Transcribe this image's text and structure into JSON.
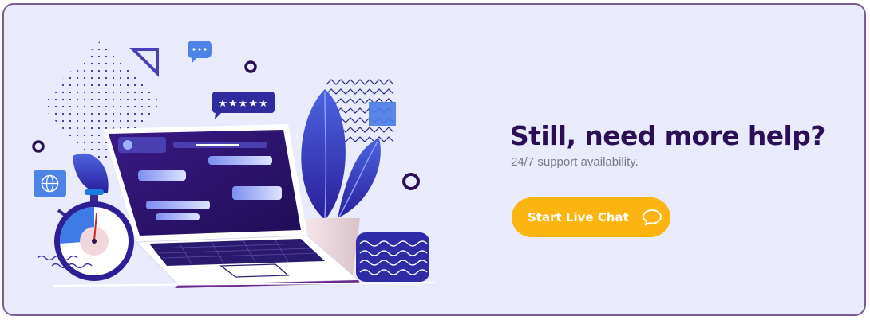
{
  "banner": {
    "headline": "Still, need more help?",
    "subline": "24/7 support availability.",
    "cta": {
      "label": "Start Live Chat",
      "icon": "chat-bubble-icon"
    }
  },
  "illustration": {
    "rating_stars": "★★★★★"
  },
  "colors": {
    "background": "#e9ebfd",
    "border": "#7b5c98",
    "headline": "#2b0e55",
    "subline": "#777b86",
    "accent": "#fbb410",
    "primary": "#3b2fb4"
  }
}
